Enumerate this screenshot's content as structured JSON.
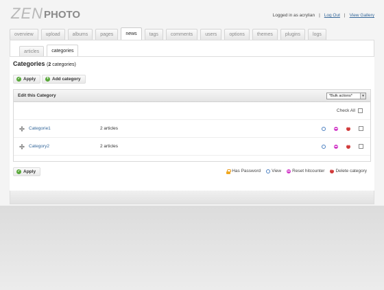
{
  "brand": {
    "logo_zen": "ZEN",
    "logo_photo": "PHOTO"
  },
  "userbar": {
    "logged_in": "Logged in as acrylian",
    "logout": "Log Out",
    "view_gallery": "View Gallery"
  },
  "tabs": [
    {
      "label": "overview",
      "active": false
    },
    {
      "label": "upload",
      "active": false
    },
    {
      "label": "albums",
      "active": false
    },
    {
      "label": "pages",
      "active": false
    },
    {
      "label": "news",
      "active": true
    },
    {
      "label": "tags",
      "active": false
    },
    {
      "label": "comments",
      "active": false
    },
    {
      "label": "users",
      "active": false
    },
    {
      "label": "options",
      "active": false
    },
    {
      "label": "themes",
      "active": false
    },
    {
      "label": "plugins",
      "active": false
    },
    {
      "label": "logs",
      "active": false
    }
  ],
  "subtabs": [
    {
      "label": "articles",
      "active": false
    },
    {
      "label": "categories",
      "active": true
    }
  ],
  "heading": {
    "title": "Categories",
    "count_open": "(",
    "count_num": "2",
    "count_rest": "categories)"
  },
  "buttons": {
    "apply": "Apply",
    "add_category": "Add category"
  },
  "table": {
    "title": "Edit this Category",
    "bulk_select": "*Bulk actions*",
    "check_all": "Check All",
    "rows": [
      {
        "name": "Categorie1",
        "articles": "2 articles"
      },
      {
        "name": "Category2",
        "articles": "2 articles"
      }
    ]
  },
  "legend": {
    "has_password": "Has Password",
    "view": "View",
    "reset": "Reset hitcounter",
    "delete": "Delete category"
  },
  "colors": {
    "link": "#336699",
    "view": "#4a7fc0",
    "reset": "#d23ac8",
    "delete": "#d13a3a",
    "apply_icon": "#59a83a"
  }
}
